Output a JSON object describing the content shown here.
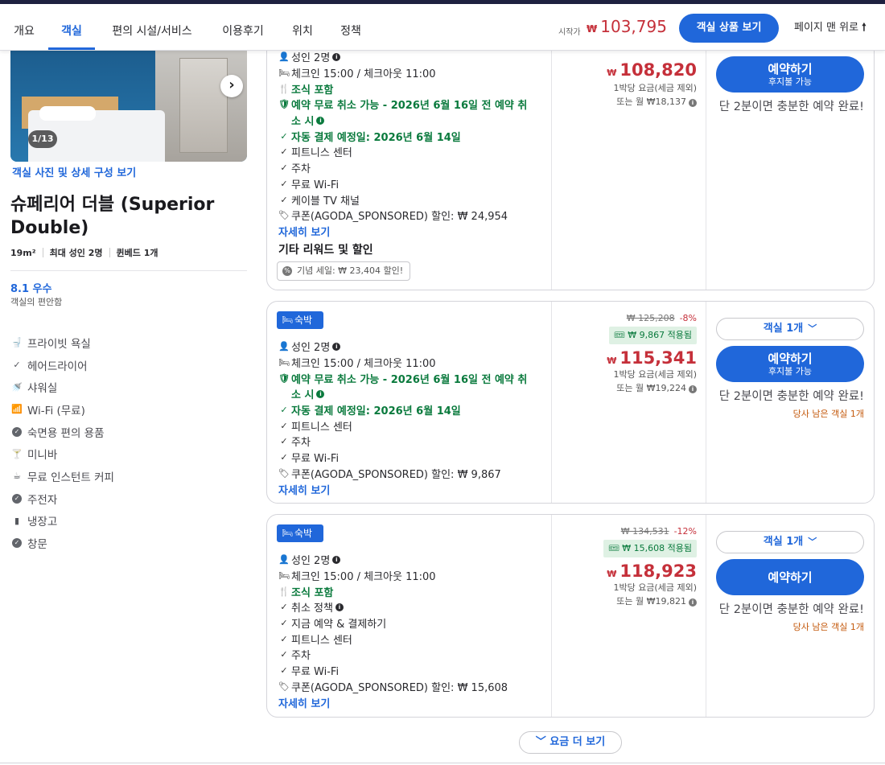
{
  "nav": {
    "tabs": [
      "개요",
      "객실",
      "편의 시설/서비스",
      "이용후기",
      "위치",
      "정책"
    ],
    "active_tab": "객실",
    "price_from_label": "시작가",
    "price_from_currency": "₩",
    "price_from_value": "103,795",
    "view_rooms_button": "객실 상품 보기",
    "back_to_top": "페이지 맨 위로",
    "back_to_top_icon": "arrow-up-icon"
  },
  "room": {
    "photo_counter": "1/13",
    "photo_link": "객실 사진 및 상세 구성 보기",
    "name": "슈페리어 더블 (Superior Double)",
    "size": "19m²",
    "max_occupancy": "최대 성인 2명",
    "bed": "퀸베드 1개",
    "score": "8.1 우수",
    "score_sub": "객실의 편안함",
    "amenities": [
      {
        "icon": "toilet-icon",
        "label": "프라이빗 욕실"
      },
      {
        "icon": "check-icon",
        "label": "헤어드라이어"
      },
      {
        "icon": "shower-icon",
        "label": "샤워실"
      },
      {
        "icon": "wifi-icon",
        "label": "Wi-Fi (무료)"
      },
      {
        "icon": "check-circle-icon",
        "label": "숙면용 편의 용품"
      },
      {
        "icon": "cocktail-icon",
        "label": "미니바"
      },
      {
        "icon": "coffee-icon",
        "label": "무료 인스턴트 커피"
      },
      {
        "icon": "check-circle-icon",
        "label": "주전자"
      },
      {
        "icon": "fridge-icon",
        "label": "냉장고"
      },
      {
        "icon": "check-circle-icon",
        "label": "창문"
      }
    ]
  },
  "offers": [
    {
      "lines": [
        {
          "icon": "person-icon",
          "text": "성인 2명",
          "info": true,
          "style": "normal"
        },
        {
          "icon": "bed-icon",
          "text": "체크인 15:00 / 체크아웃 11:00",
          "style": "normal"
        },
        {
          "icon": "fork-knife-icon",
          "text": "조식 포함",
          "style": "green"
        },
        {
          "icon": "shield-check-icon",
          "text": "예약 무료 취소 가능 - 2026년 6월 16일 전 예약 취",
          "style": "green"
        },
        {
          "icon": "",
          "text": "소 시",
          "info": true,
          "style": "green"
        },
        {
          "icon": "check-icon",
          "text": "자동 결제 예정일: 2026년 6월 14일",
          "style": "green"
        },
        {
          "icon": "check-icon",
          "text": "피트니스 센터",
          "style": "normal"
        },
        {
          "icon": "check-icon",
          "text": "주차",
          "style": "normal"
        },
        {
          "icon": "check-icon",
          "text": "무료 Wi-Fi",
          "style": "normal"
        },
        {
          "icon": "check-icon",
          "text": "케이블 TV 채널",
          "style": "normal"
        },
        {
          "icon": "tag-icon",
          "text": "쿠폰(AGODA_SPONSORED) 할인: ₩ 24,954",
          "style": "normal"
        },
        {
          "icon": "",
          "text": "자세히 보기",
          "style": "link"
        }
      ],
      "other_title": "기타 리워드 및 할인",
      "event_chip": "기념 세일: ₩ 23,404 할인!",
      "price_currency": "₩",
      "price": "108,820",
      "per_night": "1박당 요금(세금 제외)",
      "monthly": "또는 월 ₩18,137",
      "book_label": "예약하기",
      "book_sub": "후지불 가능",
      "fast_msg": "단 2분이면 충분한 예약 완료!"
    },
    {
      "badge": "숙박",
      "lines": [
        {
          "icon": "person-icon",
          "text": "성인 2명",
          "info": true,
          "style": "normal"
        },
        {
          "icon": "bed-icon",
          "text": "체크인 15:00 / 체크아웃 11:00",
          "style": "normal"
        },
        {
          "icon": "shield-check-icon",
          "text": "예약 무료 취소 가능 - 2026년 6월 16일 전 예약 취",
          "style": "green"
        },
        {
          "icon": "",
          "text": "소 시",
          "info": true,
          "style": "green"
        },
        {
          "icon": "check-icon",
          "text": "자동 결제 예정일: 2026년 6월 14일",
          "style": "green"
        },
        {
          "icon": "check-icon",
          "text": "피트니스 센터",
          "style": "normal"
        },
        {
          "icon": "check-icon",
          "text": "주차",
          "style": "normal"
        },
        {
          "icon": "check-icon",
          "text": "무료 Wi-Fi",
          "style": "normal"
        },
        {
          "icon": "tag-icon",
          "text": "쿠폰(AGODA_SPONSORED) 할인: ₩ 9,867",
          "style": "normal"
        },
        {
          "icon": "",
          "text": "자세히 보기",
          "style": "link"
        }
      ],
      "orig_price": "₩ 125,208",
      "discount": "-8%",
      "coupon_applied": "₩ 9,867 적용됨",
      "price_currency": "₩",
      "price": "115,341",
      "per_night": "1박당 요금(세금 제외)",
      "monthly": "또는 월 ₩19,224",
      "qty": "객실 1개",
      "book_label": "예약하기",
      "book_sub": "후지불 가능",
      "fast_msg": "단 2분이면 충분한 예약 완료!",
      "left_msg": "당사 남은 객실 1개"
    },
    {
      "badge": "숙박",
      "lines": [
        {
          "icon": "person-icon",
          "text": "성인 2명",
          "info": true,
          "style": "normal"
        },
        {
          "icon": "bed-icon",
          "text": "체크인 15:00 / 체크아웃 11:00",
          "style": "normal"
        },
        {
          "icon": "fork-knife-icon",
          "text": "조식 포함",
          "style": "green"
        },
        {
          "icon": "check-icon",
          "text": "취소 정책",
          "info": true,
          "style": "normal"
        },
        {
          "icon": "check-icon",
          "text": "지금 예약 & 결제하기",
          "style": "normal"
        },
        {
          "icon": "check-icon",
          "text": "피트니스 센터",
          "style": "normal"
        },
        {
          "icon": "check-icon",
          "text": "주차",
          "style": "normal"
        },
        {
          "icon": "check-icon",
          "text": "무료 Wi-Fi",
          "style": "normal"
        },
        {
          "icon": "tag-icon",
          "text": "쿠폰(AGODA_SPONSORED) 할인: ₩ 15,608",
          "style": "normal"
        },
        {
          "icon": "",
          "text": "자세히 보기",
          "style": "link"
        }
      ],
      "orig_price": "₩ 134,531",
      "discount": "-12%",
      "coupon_applied": "₩ 15,608 적용됨",
      "price_currency": "₩",
      "price": "118,923",
      "per_night": "1박당 요금(세금 제외)",
      "monthly": "또는 월 ₩19,821",
      "qty": "객실 1개",
      "book_label": "예약하기",
      "fast_msg": "단 2분이면 충분한 예약 완료!",
      "left_msg": "당사 남은 객실 1개"
    }
  ],
  "more_rates": "요금 더 보기"
}
